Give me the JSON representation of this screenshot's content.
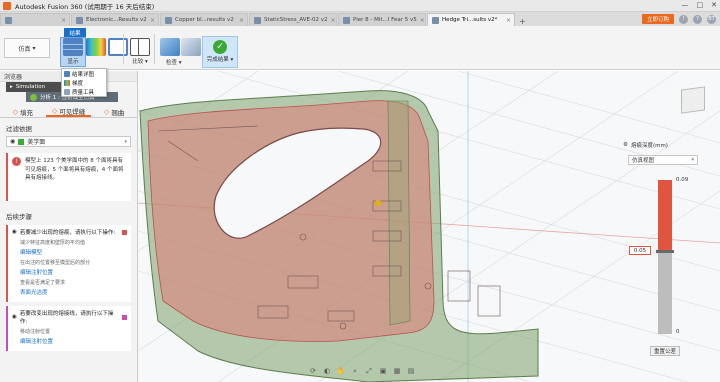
{
  "window": {
    "title": "Autodesk Fusion 360 (试用期于 16 天后结束)",
    "controls": [
      "—",
      "□",
      "✕"
    ]
  },
  "doc_tabs": [
    {
      "label": "",
      "active": false
    },
    {
      "label": "Electronic...Results v2",
      "active": false
    },
    {
      "label": "Copper bl...results v2",
      "active": false
    },
    {
      "label": "StaticStress_AVE-02 v2",
      "active": false
    },
    {
      "label": "Pier 8 - Mit...I Fear 5 v5",
      "active": false
    },
    {
      "label": "Hedge Tri...sults v2*",
      "active": true
    }
  ],
  "header_right": {
    "plus_label": "+",
    "trial_button": "立即订购",
    "user_initials": "BT"
  },
  "toolbar": {
    "workspace_label": "仿真",
    "active_tab": "结果",
    "display_label": "显示",
    "compare_label": "比较",
    "inspect_label": "检查",
    "finish_label": "完成结果"
  },
  "dropdown": {
    "items": [
      "结果详图",
      "梯度",
      "质量工具"
    ]
  },
  "browser": {
    "header": "浏览器",
    "root_label": "Simulation",
    "study_label": "分析 1 : 注射成型仿真"
  },
  "pane_tabs": [
    "填充",
    "可见焊缝",
    "翘曲"
  ],
  "filter": {
    "header": "过滤依据",
    "selected": "美学面"
  },
  "warning_text": "模型上 123 个美学面中的 8 个面将具有可见熔痕，5 个面将具有熔痕，4 个面将具有熔接线。",
  "next_steps": {
    "header": "后续步骤",
    "cards": [
      {
        "title": "若要减少出现的熔痕，请执行以下操作:",
        "sub1": "减少特征高度和壁厚的平均值",
        "link1": "编辑模型",
        "sub2": "在出注的位置移至模型后的部分",
        "link2": "编辑注射位置",
        "sub3": "查看是否满足了要求",
        "link3": "表面光洁度"
      },
      {
        "title": "若要改变出现的熔接线，请执行以下操作:",
        "sub1": "移动注射位置",
        "link1": "编辑注射位置"
      }
    ]
  },
  "legend": {
    "title": "熔痕深度(mm)",
    "view_option": "仿真视图",
    "max_label": "0.09",
    "min_label": "0",
    "threshold_value": "0.05",
    "threshold_fraction": 0.46,
    "reset_label": "重置公差"
  },
  "colors": {
    "accent": "#e8691f",
    "highlight_blue": "#1a6fc9",
    "melt_red": "#e05540",
    "part_green": "#7ea36a",
    "part_red": "#e07a78"
  },
  "icons": {
    "titlebar": "fusion-logo-icon",
    "info": "info-icon",
    "eye": "eye-icon",
    "warn": "warning-icon"
  }
}
